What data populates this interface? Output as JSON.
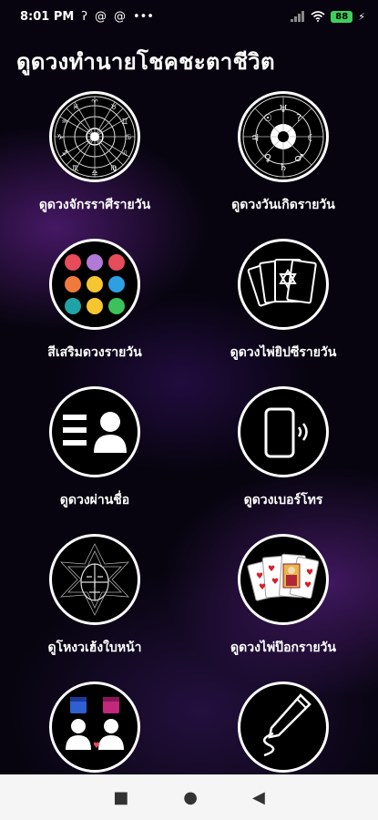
{
  "status_bar": {
    "time": "8:01 PM",
    "icons": [
      "nfc-icon",
      "at-icon",
      "at-icon",
      "more-dots-icon"
    ],
    "battery": "88"
  },
  "title": "ดูดวงทำนายโชคชะตาชีวิต",
  "items": [
    {
      "label": "ดูดวงจักรราศีรายวัน",
      "icon": "zodiac-wheel-icon"
    },
    {
      "label": "ดูดวงวันเกิดรายวัน",
      "icon": "astrology-chart-icon"
    },
    {
      "label": "สีเสริมดวงรายวัน",
      "icon": "color-dots-icon"
    },
    {
      "label": "ดูดวงไพ่ยิปซีรายวัน",
      "icon": "tarot-cards-icon"
    },
    {
      "label": "ดูดวงผ่านชื่อ",
      "icon": "name-card-icon"
    },
    {
      "label": "ดูดวงเบอร์โทร",
      "icon": "phone-icon"
    },
    {
      "label": "ดูโหงวเฮ้งใบหน้า",
      "icon": "face-reading-icon"
    },
    {
      "label": "ดูดวงไพ่ป๊อกรายวัน",
      "icon": "playing-cards-icon"
    },
    {
      "label": "",
      "icon": "couple-calendar-icon"
    },
    {
      "label": "",
      "icon": "signature-pen-icon"
    }
  ],
  "colors": {
    "dots": [
      "#e74c5a",
      "#b07ad6",
      "#e74c5a",
      "#ef7a3c",
      "#f6c630",
      "#2f9fe3",
      "#1fa3a6",
      "#f6c630",
      "#3cc25a"
    ]
  },
  "nav": {
    "recent": "■",
    "home": "●",
    "back": "◀"
  }
}
